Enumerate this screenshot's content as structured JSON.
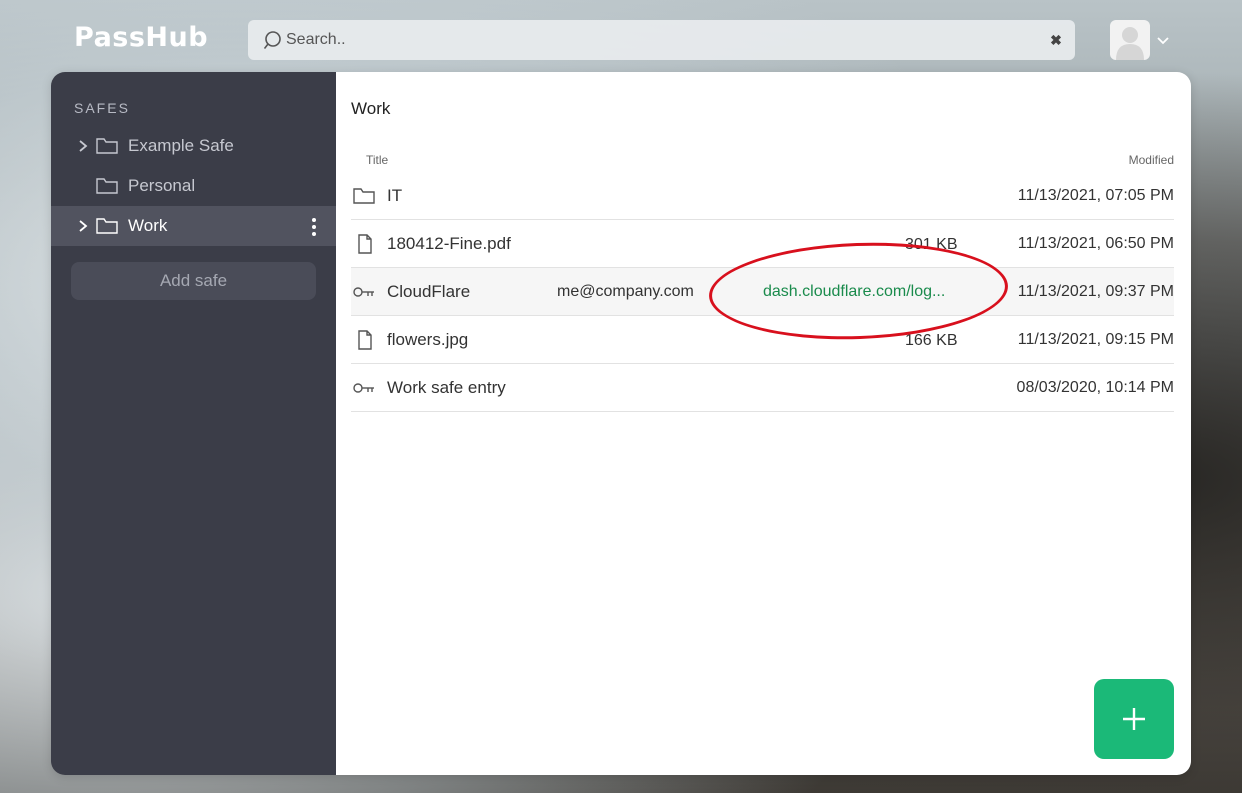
{
  "app": {
    "logo": "PassHub"
  },
  "search": {
    "placeholder": "Search..",
    "value": ""
  },
  "sidebar": {
    "title": "SAFES",
    "safes": [
      {
        "label": "Example Safe",
        "expandable": true,
        "active": false
      },
      {
        "label": "Personal",
        "expandable": false,
        "active": false
      },
      {
        "label": "Work",
        "expandable": true,
        "active": true
      }
    ],
    "add_safe_label": "Add safe"
  },
  "main": {
    "breadcrumb": "Work",
    "columns": {
      "title": "Title",
      "modified": "Modified"
    },
    "rows": [
      {
        "type": "folder",
        "title": "IT",
        "login": "",
        "url": "",
        "size": "",
        "modified": "11/13/2021, 07:05 PM"
      },
      {
        "type": "file",
        "title": "180412-Fine.pdf",
        "login": "",
        "url": "",
        "size": "301 KB",
        "modified": "11/13/2021, 06:50 PM"
      },
      {
        "type": "password",
        "title": "CloudFlare",
        "login": "me@company.com",
        "url": "dash.cloudflare.com/log...",
        "size": "",
        "modified": "11/13/2021, 09:37 PM"
      },
      {
        "type": "file",
        "title": "flowers.jpg",
        "login": "",
        "url": "",
        "size": "166 KB",
        "modified": "11/13/2021, 09:15 PM"
      },
      {
        "type": "password",
        "title": "Work safe entry",
        "login": "",
        "url": "",
        "size": "",
        "modified": "08/03/2020, 10:14 PM"
      }
    ]
  },
  "colors": {
    "accent": "#1bb978",
    "url": "#1a8b4c",
    "sidebar": "#3b3d48",
    "annotation": "#d8101d"
  }
}
